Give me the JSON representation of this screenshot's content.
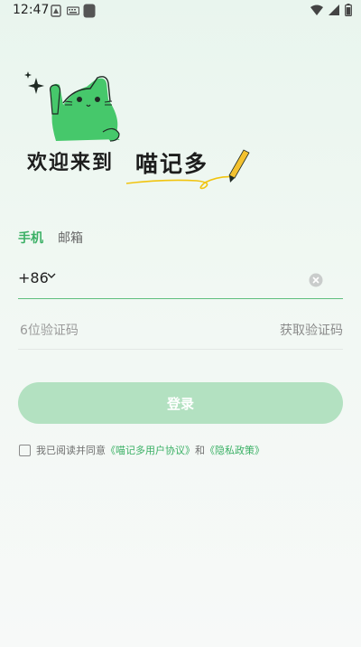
{
  "status_bar": {
    "time": "12:47"
  },
  "hero": {
    "welcome_text": "欢迎来到",
    "app_name": "喵记多"
  },
  "tabs": [
    {
      "label": "手机",
      "active": true
    },
    {
      "label": "邮箱",
      "active": false
    }
  ],
  "phone": {
    "country_code": "+86",
    "value": "",
    "placeholder": ""
  },
  "code": {
    "placeholder": "6位验证码",
    "get_code_label": "获取验证码"
  },
  "login": {
    "label": "登录"
  },
  "agreement": {
    "prefix": "我已阅读并同意",
    "user_agreement": "《喵记多用户协议》",
    "and": "和",
    "privacy_policy": "《隐私政策》"
  },
  "colors": {
    "accent": "#3bb065",
    "login_button_disabled": "#b3e1c1",
    "cat_green": "#46c86b"
  },
  "icons": [
    "sim-icon",
    "keyboard-icon",
    "app-icon",
    "wifi-icon",
    "signal-icon",
    "battery-icon",
    "chevron-down-icon",
    "clear-icon",
    "sparkle-icon",
    "pencil-icon"
  ]
}
